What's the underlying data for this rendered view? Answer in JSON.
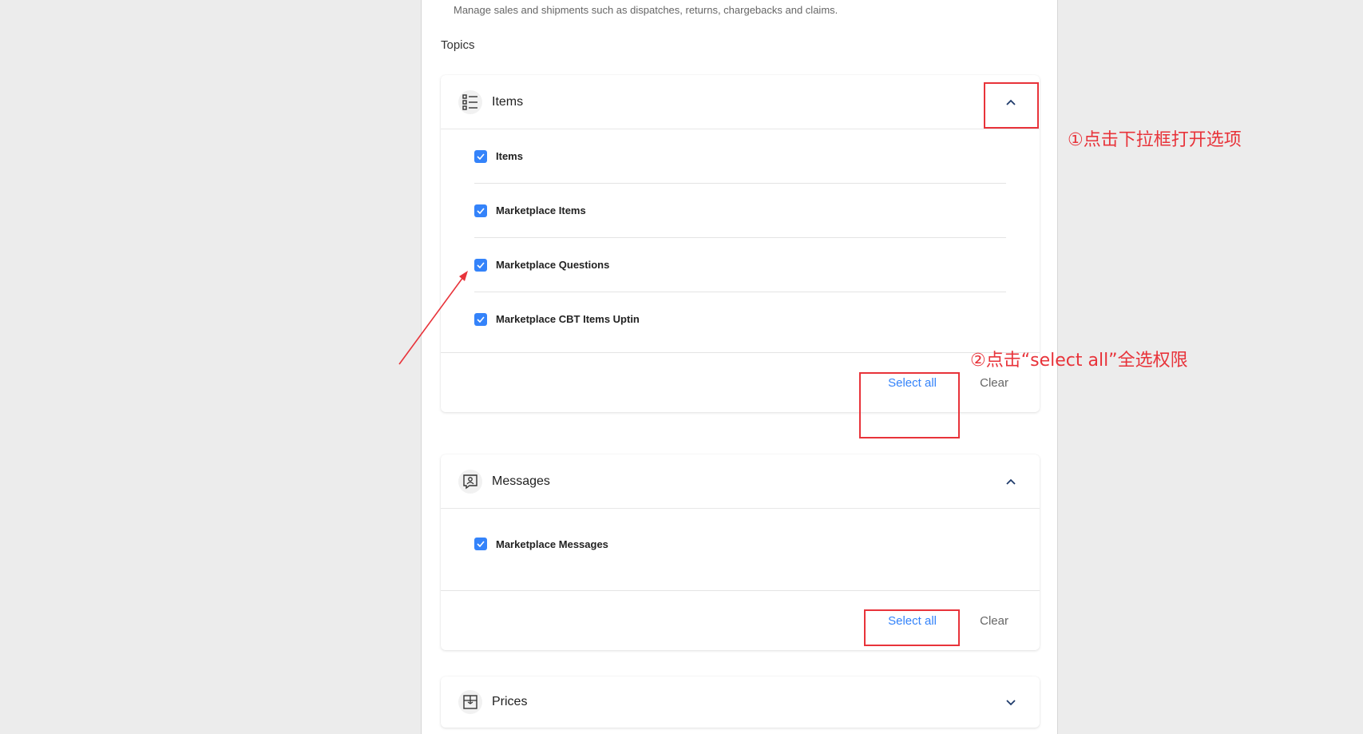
{
  "description": "Manage sales and shipments such as dispatches, returns, chargebacks and claims.",
  "topics_label": "Topics",
  "sections": [
    {
      "title": "Items",
      "icon": "list-icon",
      "expanded": true,
      "options": [
        {
          "label": "Items",
          "checked": true
        },
        {
          "label": "Marketplace Items",
          "checked": true
        },
        {
          "label": "Marketplace Questions",
          "checked": true
        },
        {
          "label": "Marketplace CBT Items Uptin",
          "checked": true
        }
      ],
      "select_all_label": "Select all",
      "clear_label": "Clear"
    },
    {
      "title": "Messages",
      "icon": "message-contact-icon",
      "expanded": true,
      "options": [
        {
          "label": "Marketplace Messages",
          "checked": true
        }
      ],
      "select_all_label": "Select all",
      "clear_label": "Clear"
    },
    {
      "title": "Prices",
      "icon": "price-tag-icon",
      "expanded": false
    }
  ],
  "annotations": {
    "step1": "①点击下拉框打开选项",
    "step2": "②点击“select all”全选权限"
  },
  "colors": {
    "accent": "#3483fa",
    "annotation": "#e8333a",
    "background": "#ececec"
  }
}
